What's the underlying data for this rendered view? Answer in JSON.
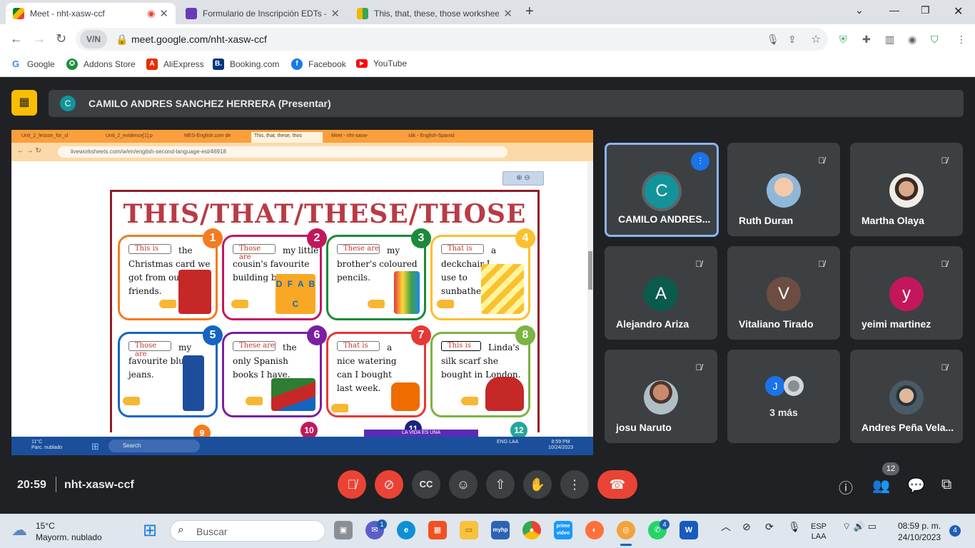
{
  "browser": {
    "tabs": [
      {
        "title": "Meet - nht-xasw-ccf",
        "active": true,
        "recording": true
      },
      {
        "title": "Formulario de Inscripción EDTs -",
        "active": false
      },
      {
        "title": "This, that, these, those workshee",
        "active": false
      }
    ],
    "new_tab_glyph": "+",
    "url": "meet.google.com/nht-xasw-ccf",
    "vpn_label": "V/N",
    "bookmarks": [
      "Google",
      "Addons Store",
      "AliExpress",
      "Booking.com",
      "Facebook",
      "YouTube"
    ]
  },
  "meet": {
    "presenter_initial": "C",
    "presenter_label": "CAMILO ANDRES SANCHEZ HERRERA (Presentar)",
    "shared_screen": {
      "tabs": [
        "Unit_2_lesson_for_cl",
        "Unit_2_evidence[1].p",
        "MES-English.com de",
        "This, that, these, thos",
        "Meet - nht-xasw-",
        "silk - English-Spanisl"
      ],
      "url": "liveworksheets.com/w/en/english-second-language-esl/46918",
      "worksheet_title": "THIS/THAT/THESE/THOSE",
      "cards": [
        {
          "num": "1",
          "answer": "This is",
          "text": "the Christmas card we got from our friends."
        },
        {
          "num": "2",
          "answer": "Those are",
          "text": "my little cousin's favourite building blocks."
        },
        {
          "num": "3",
          "answer": "These are",
          "text": "my brother's coloured pencils."
        },
        {
          "num": "4",
          "answer": "That is",
          "text": "a deckchair I use to sunbathe."
        },
        {
          "num": "5",
          "answer": "Those are",
          "text": "my favourite blue jeans."
        },
        {
          "num": "6",
          "answer": "These are",
          "text": "the only Spanish books I have."
        },
        {
          "num": "7",
          "answer": "That is",
          "text": "a nice watering can I bought last week."
        },
        {
          "num": "8",
          "answer": "This is",
          "text": "Linda's silk scarf she bought in London."
        }
      ],
      "blocks_letters": "D F A B C",
      "next_nums": [
        "9",
        "10",
        "11",
        "12"
      ],
      "taskbar": {
        "weather_temp": "11°C",
        "weather_desc": "Parc. nublado",
        "search": "Search",
        "lang": "ENG LAA",
        "time": "8:59 PM",
        "date": "10/24/2023",
        "banner": "LA VIDA ES UNA"
      }
    },
    "participants": [
      {
        "name": "CAMILO ANDRES...",
        "initial": "C",
        "color": "#12939a",
        "speaking": true
      },
      {
        "name": "Ruth Duran",
        "initial": "",
        "color": "#8fb7d9",
        "muted": true
      },
      {
        "name": "Martha Olaya",
        "initial": "",
        "color": "#caa88f",
        "muted": true
      },
      {
        "name": "Alejandro Ariza",
        "initial": "A",
        "color": "#0b5b4c",
        "muted": true
      },
      {
        "name": "Vitaliano Tirado",
        "initial": "V",
        "color": "#6d4c41",
        "muted": true
      },
      {
        "name": "yeimi martinez",
        "initial": "y",
        "color": "#c2185b",
        "muted": true
      },
      {
        "name": "josu Naruto",
        "initial": "",
        "color": "#9c6b55",
        "muted": true
      },
      {
        "name": "3 más",
        "initial": "J",
        "color": "#1a73e8"
      },
      {
        "name": "Andres Peña Vela...",
        "initial": "",
        "color": "#4a5a66",
        "muted": true
      }
    ],
    "time": "20:59",
    "meeting_code": "nht-xasw-ccf",
    "people_count": "12"
  },
  "taskbar": {
    "weather_temp": "15°C",
    "weather_desc": "Mayorm. nublado",
    "search_placeholder": "Buscar",
    "lang_top": "ESP",
    "lang_bottom": "LAA",
    "time": "08:59 p. m.",
    "date": "24/10/2023",
    "notifications": "4",
    "teams_badge": "1",
    "whatsapp_badge": "4"
  }
}
